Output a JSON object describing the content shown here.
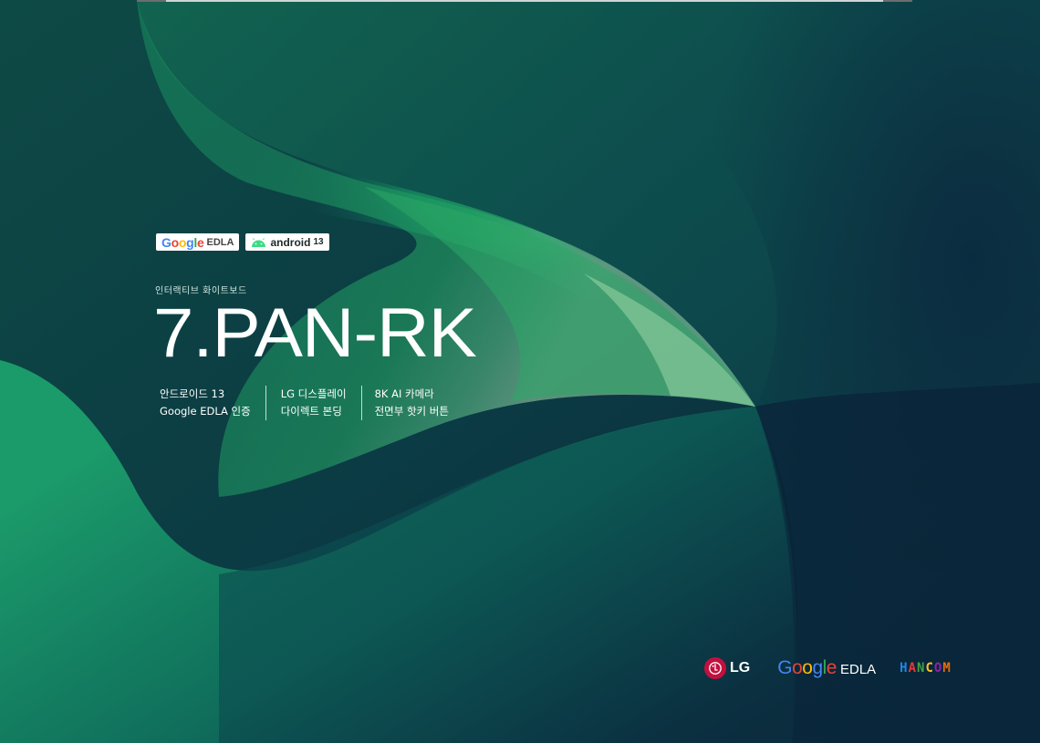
{
  "badges": {
    "google": {
      "letters": [
        "G",
        "o",
        "o",
        "g",
        "l",
        "e"
      ],
      "suffix": "EDLA"
    },
    "android": {
      "label": "android",
      "version": "13"
    }
  },
  "product": {
    "category": "인터랙티브 화이트보드",
    "model": "7.PAN-RK"
  },
  "features": [
    {
      "line1": "안드로이드 13",
      "line2": "Google EDLA 인증"
    },
    {
      "line1": "LG 디스플레이",
      "line2": "다이렉트 본딩"
    },
    {
      "line1": "8K AI 카메라",
      "line2": "전면부 핫키 버튼"
    }
  ],
  "partners": {
    "lg": "LG",
    "google_letters": [
      "G",
      "o",
      "o",
      "g",
      "l",
      "e"
    ],
    "google_suffix": "EDLA",
    "hancom_letters": [
      "H",
      "A",
      "N",
      "C",
      "O",
      "M"
    ]
  },
  "colors": {
    "background_dark": "#0b2c3a",
    "green_accent": "#1fa560",
    "lg_red": "#c3103f",
    "google_blue": "#4285f4",
    "google_red": "#ea4335",
    "google_yellow": "#fbbc05",
    "google_green": "#34a853",
    "hancom": [
      "#1e88e5",
      "#e53935",
      "#43a047",
      "#fbc02d",
      "#8e24aa",
      "#ef6c00"
    ]
  }
}
